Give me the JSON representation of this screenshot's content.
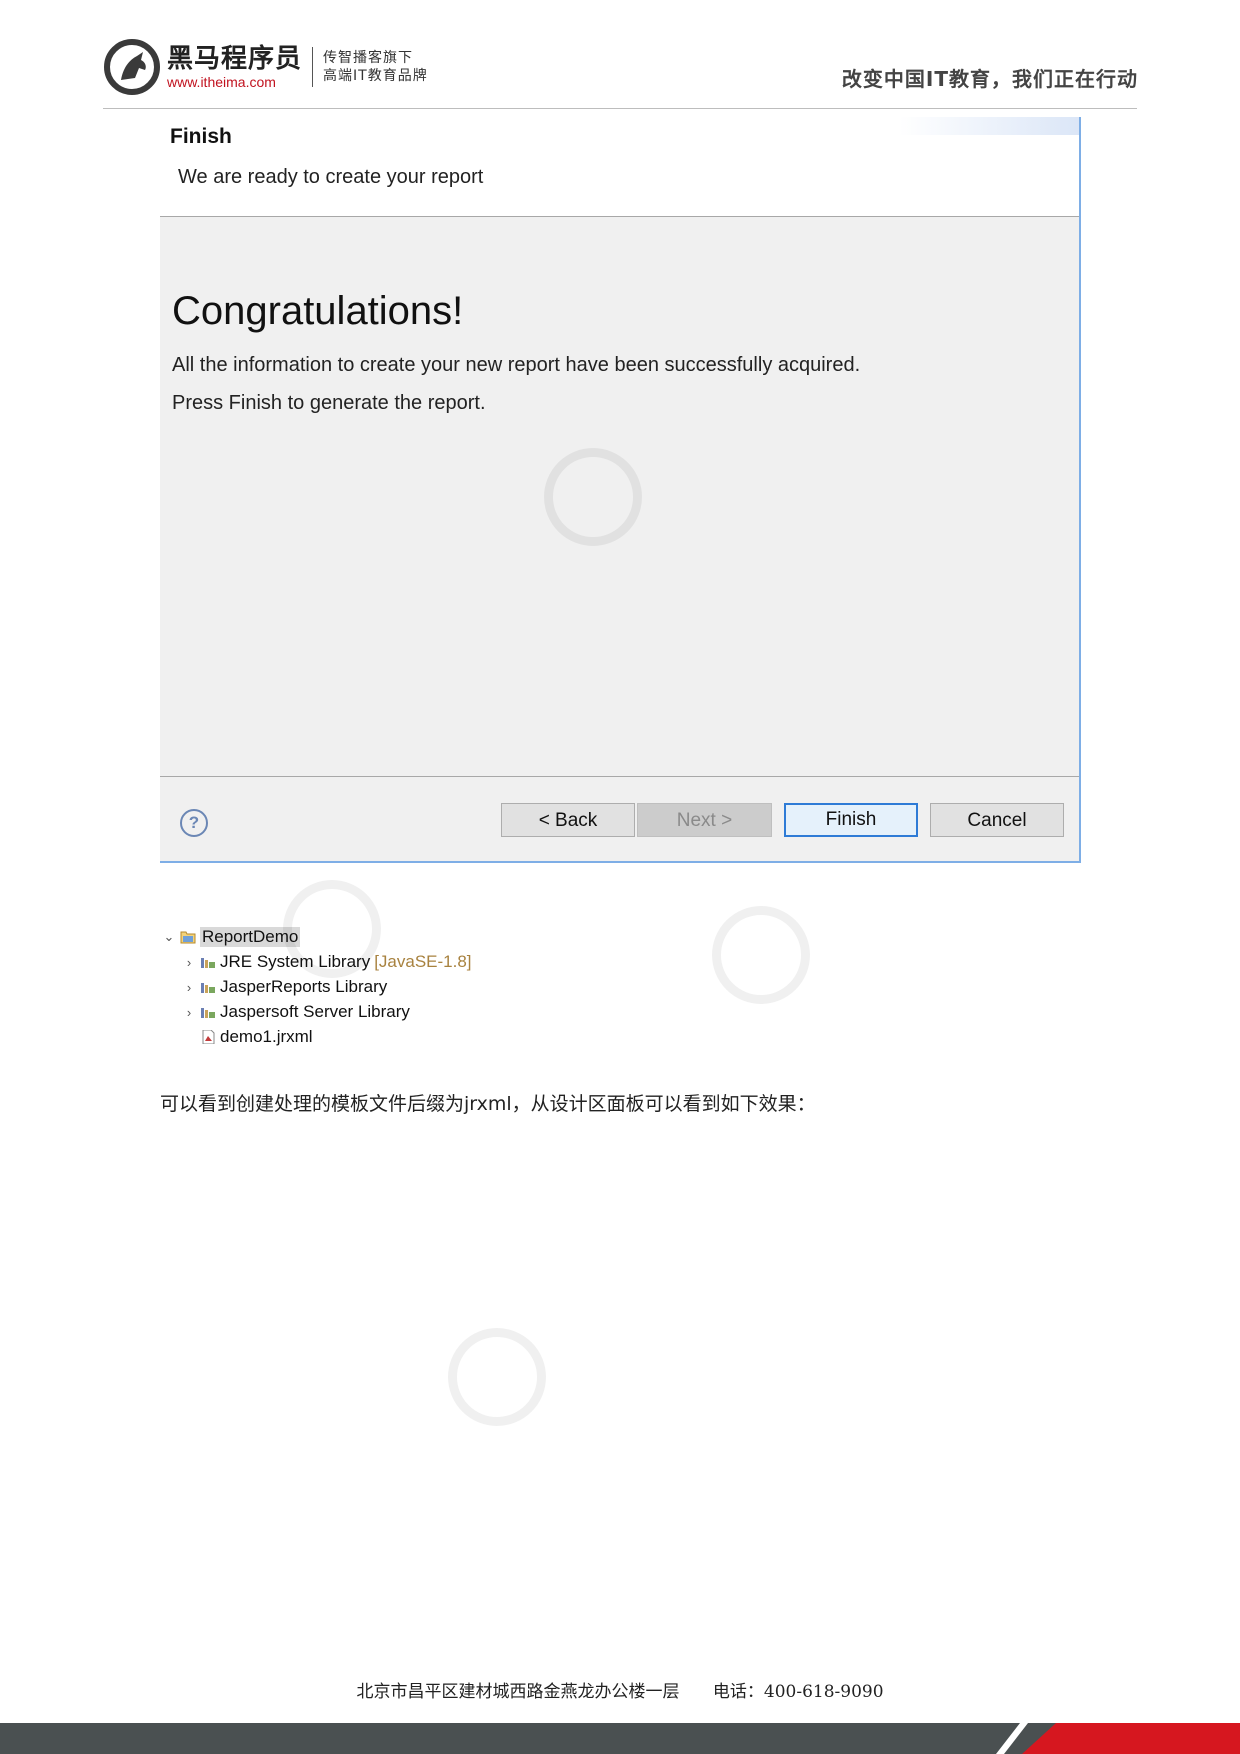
{
  "header": {
    "brand_cn": "黑马程序员",
    "brand_url": "www.itheima.com",
    "slogan_line1": "传智播客旗下",
    "slogan_line2": "高端IT教育品牌",
    "tagline": "改变中国IT教育，我们正在行动"
  },
  "dialog": {
    "title": "Finish",
    "subtitle": "We are ready to create your report",
    "heading": "Congratulations!",
    "line1": "All the information to create your new report have been successfully acquired.",
    "line2": "Press Finish to generate the report.",
    "help_glyph": "?",
    "buttons": {
      "back": "< Back",
      "next": "Next >",
      "finish": "Finish",
      "cancel": "Cancel"
    }
  },
  "tree": {
    "project": "ReportDemo",
    "items": [
      {
        "label": "JRE System Library",
        "suffix": "[JavaSE-1.8]"
      },
      {
        "label": "JasperReports Library",
        "suffix": ""
      },
      {
        "label": "Jaspersoft Server Library",
        "suffix": ""
      },
      {
        "label": "demo1.jrxml",
        "suffix": ""
      }
    ]
  },
  "paragraph": "可以看到创建处理的模板文件后缀为jrxml，从设计区面板可以看到如下效果：",
  "footer": {
    "address": "北京市昌平区建材城西路金燕龙办公楼一层",
    "phone": "电话：400-618-9090"
  },
  "colors": {
    "accent_blue": "#2e7bd6",
    "brand_red": "#d6171f",
    "footer_gray": "#4a5051"
  }
}
